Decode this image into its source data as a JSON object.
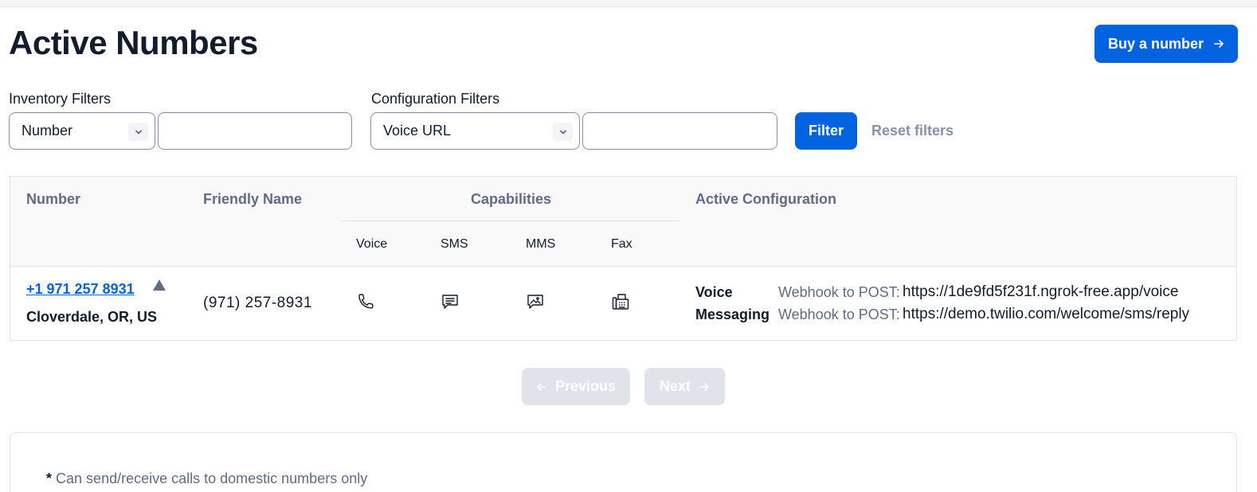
{
  "page": {
    "title": "Active Numbers"
  },
  "header": {
    "buy_button_label": "Buy a number"
  },
  "filters": {
    "inventory_label": "Inventory Filters",
    "inventory_select_value": "Number",
    "inventory_input_value": "",
    "configuration_label": "Configuration Filters",
    "configuration_select_value": "Voice URL",
    "configuration_input_value": "",
    "filter_button_label": "Filter",
    "reset_label": "Reset filters"
  },
  "table": {
    "headers": {
      "number": "Number",
      "friendly_name": "Friendly Name",
      "capabilities": "Capabilities",
      "active_configuration": "Active Configuration"
    },
    "capability_headers": [
      "Voice",
      "SMS",
      "MMS",
      "Fax"
    ],
    "rows": [
      {
        "number": "+1 971 257 8931",
        "location": "Cloverdale, OR, US",
        "friendly_name": "(971) 257-8931",
        "capabilities": [
          "phone-icon",
          "sms-icon",
          "mms-icon",
          "fax-icon"
        ],
        "config": [
          {
            "label": "Voice",
            "kind": "Webhook to POST:",
            "url": "https://1de9fd5f231f.ngrok-free.app/voice"
          },
          {
            "label": "Messaging",
            "kind": "Webhook to POST:",
            "url": "https://demo.twilio.com/welcome/sms/reply"
          }
        ]
      }
    ]
  },
  "pagination": {
    "previous_label": "Previous",
    "next_label": "Next"
  },
  "footnote": {
    "marker": "*",
    "text": "Can send/receive calls to domestic numbers only"
  },
  "colors": {
    "primary": "#0263e0",
    "text": "#121c2d",
    "muted": "#606b85",
    "border": "#e1e3ea",
    "disabled": "#e1e3ea"
  }
}
